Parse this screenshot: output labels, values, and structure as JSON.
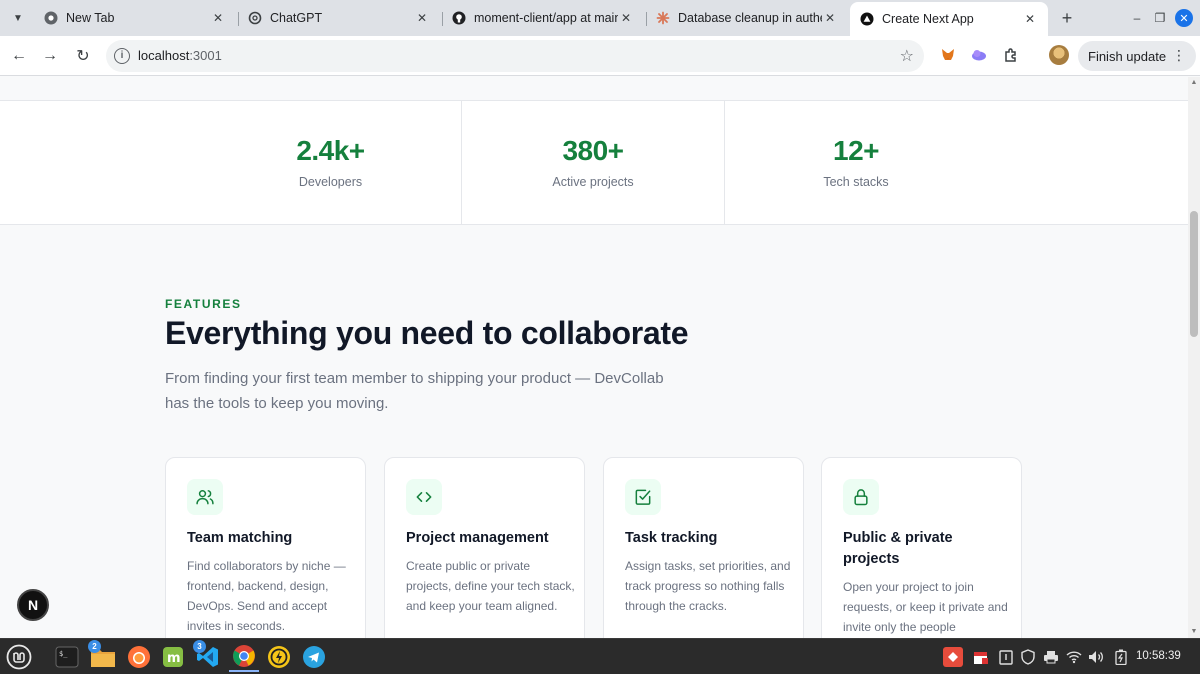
{
  "browser": {
    "tabs": [
      {
        "title": "New Tab",
        "icon": "chrome-icon"
      },
      {
        "title": "ChatGPT",
        "icon": "openai-icon"
      },
      {
        "title": "moment-client/app at main",
        "icon": "github-icon"
      },
      {
        "title": "Database cleanup in authe",
        "icon": "claude-icon"
      },
      {
        "title": "Create Next App",
        "icon": "vercel-icon",
        "active": true
      }
    ],
    "url_host": "localhost",
    "url_port": ":3001",
    "finish_update_label": "Finish update"
  },
  "stats": [
    {
      "value": "2.4k+",
      "label": "Developers"
    },
    {
      "value": "380+",
      "label": "Active projects"
    },
    {
      "value": "12+",
      "label": "Tech stacks"
    }
  ],
  "features": {
    "eyebrow": "FEATURES",
    "headline": "Everything you need to collaborate",
    "lead": "From finding your first team member to shipping your product — DevCollab has the tools to keep you moving.",
    "cards": [
      {
        "icon": "users-icon",
        "title": "Team matching",
        "description": "Find collaborators by niche — frontend, backend, design, DevOps. Send and accept invites in seconds."
      },
      {
        "icon": "code-icon",
        "title": "Project management",
        "description": "Create public or private projects, define your tech stack, and keep your team aligned."
      },
      {
        "icon": "check-square-icon",
        "title": "Task tracking",
        "description": "Assign tasks, set priorities, and track progress so nothing falls through the cracks."
      },
      {
        "icon": "lock-icon",
        "title": "Public & private projects",
        "description": "Open your project to join requests, or keep it private and invite only the people"
      }
    ]
  },
  "next_badge": "N",
  "taskbar": {
    "badges": {
      "files": "2",
      "vscode": "3"
    },
    "clock": "10:58:39"
  },
  "colors": {
    "accent": "#15803d",
    "heading": "#111827",
    "muted": "#6b7280"
  }
}
